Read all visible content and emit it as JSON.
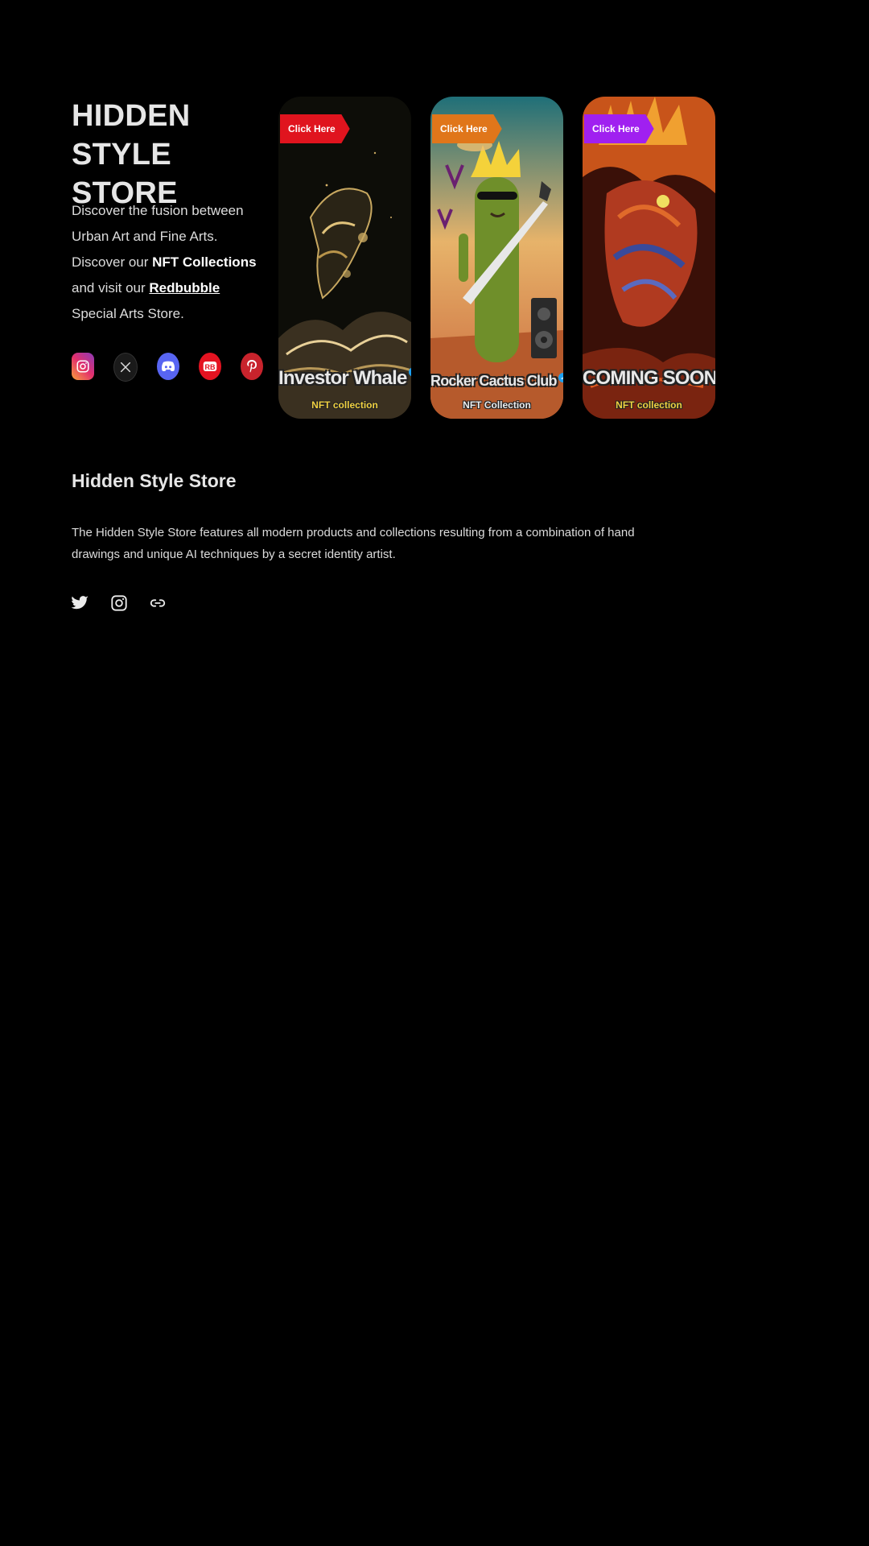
{
  "hero": {
    "title": "HIDDEN STYLE STORE",
    "desc_part1": "Discover the fusion between Urban Art and Fine Arts. Discover our ",
    "desc_bold": "NFT Collections",
    "desc_part2": " and visit our ",
    "desc_link": "Redbubble",
    "desc_part3": " Special Arts Store."
  },
  "social": [
    "instagram-icon",
    "x-icon",
    "discord-icon",
    "redbubble-icon",
    "pinterest-icon"
  ],
  "cards": [
    {
      "ribbon": "Click Here",
      "title": "Investor Whale",
      "subtitle": "NFT collection",
      "ribbon_color": "#e0141e"
    },
    {
      "ribbon": "Click Here",
      "title": "Rocker Cactus Club",
      "subtitle": "NFT Collection",
      "ribbon_color": "#e0761a"
    },
    {
      "ribbon": "Click Here",
      "title": "COMING SOON",
      "subtitle": "NFT collection",
      "ribbon_color": "#a020f0"
    }
  ],
  "section": {
    "title": "Hidden Style Store",
    "description": "The Hidden Style Store features all modern products and collections resulting from a combination of hand drawings and unique AI techniques by a secret identity artist."
  },
  "footer_icons": [
    "twitter-icon",
    "instagram-icon",
    "link-icon"
  ],
  "colors": {
    "background": "#000000",
    "text": "#e6e6e6",
    "verified": "#1da1f2"
  }
}
